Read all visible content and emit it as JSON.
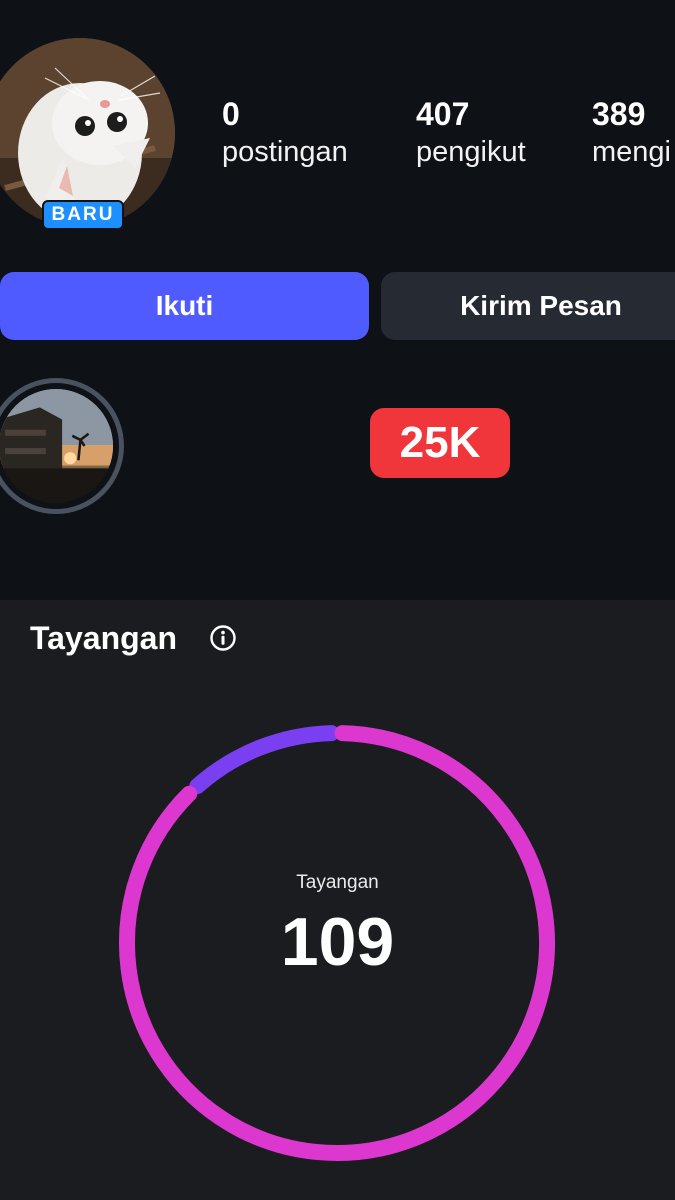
{
  "profile": {
    "badge": "BARU",
    "stats": [
      {
        "value": "0",
        "label": "postingan"
      },
      {
        "value": "407",
        "label": "pengikut"
      },
      {
        "value": "389",
        "label": "mengi"
      }
    ],
    "follow_label": "Ikuti",
    "message_label": "Kirim Pesan",
    "counter_badge": "25K"
  },
  "insights": {
    "title": "Tayangan",
    "ring_label": "Tayangan",
    "ring_value": "109",
    "segments": [
      {
        "color": "#7b3ff2",
        "fraction": 0.12
      },
      {
        "color": "#dc37cf",
        "fraction": 0.88
      }
    ]
  },
  "colors": {
    "follow_button": "#4f5bff",
    "badge_new": "#1e8fff",
    "counter_badge": "#f0363b"
  }
}
